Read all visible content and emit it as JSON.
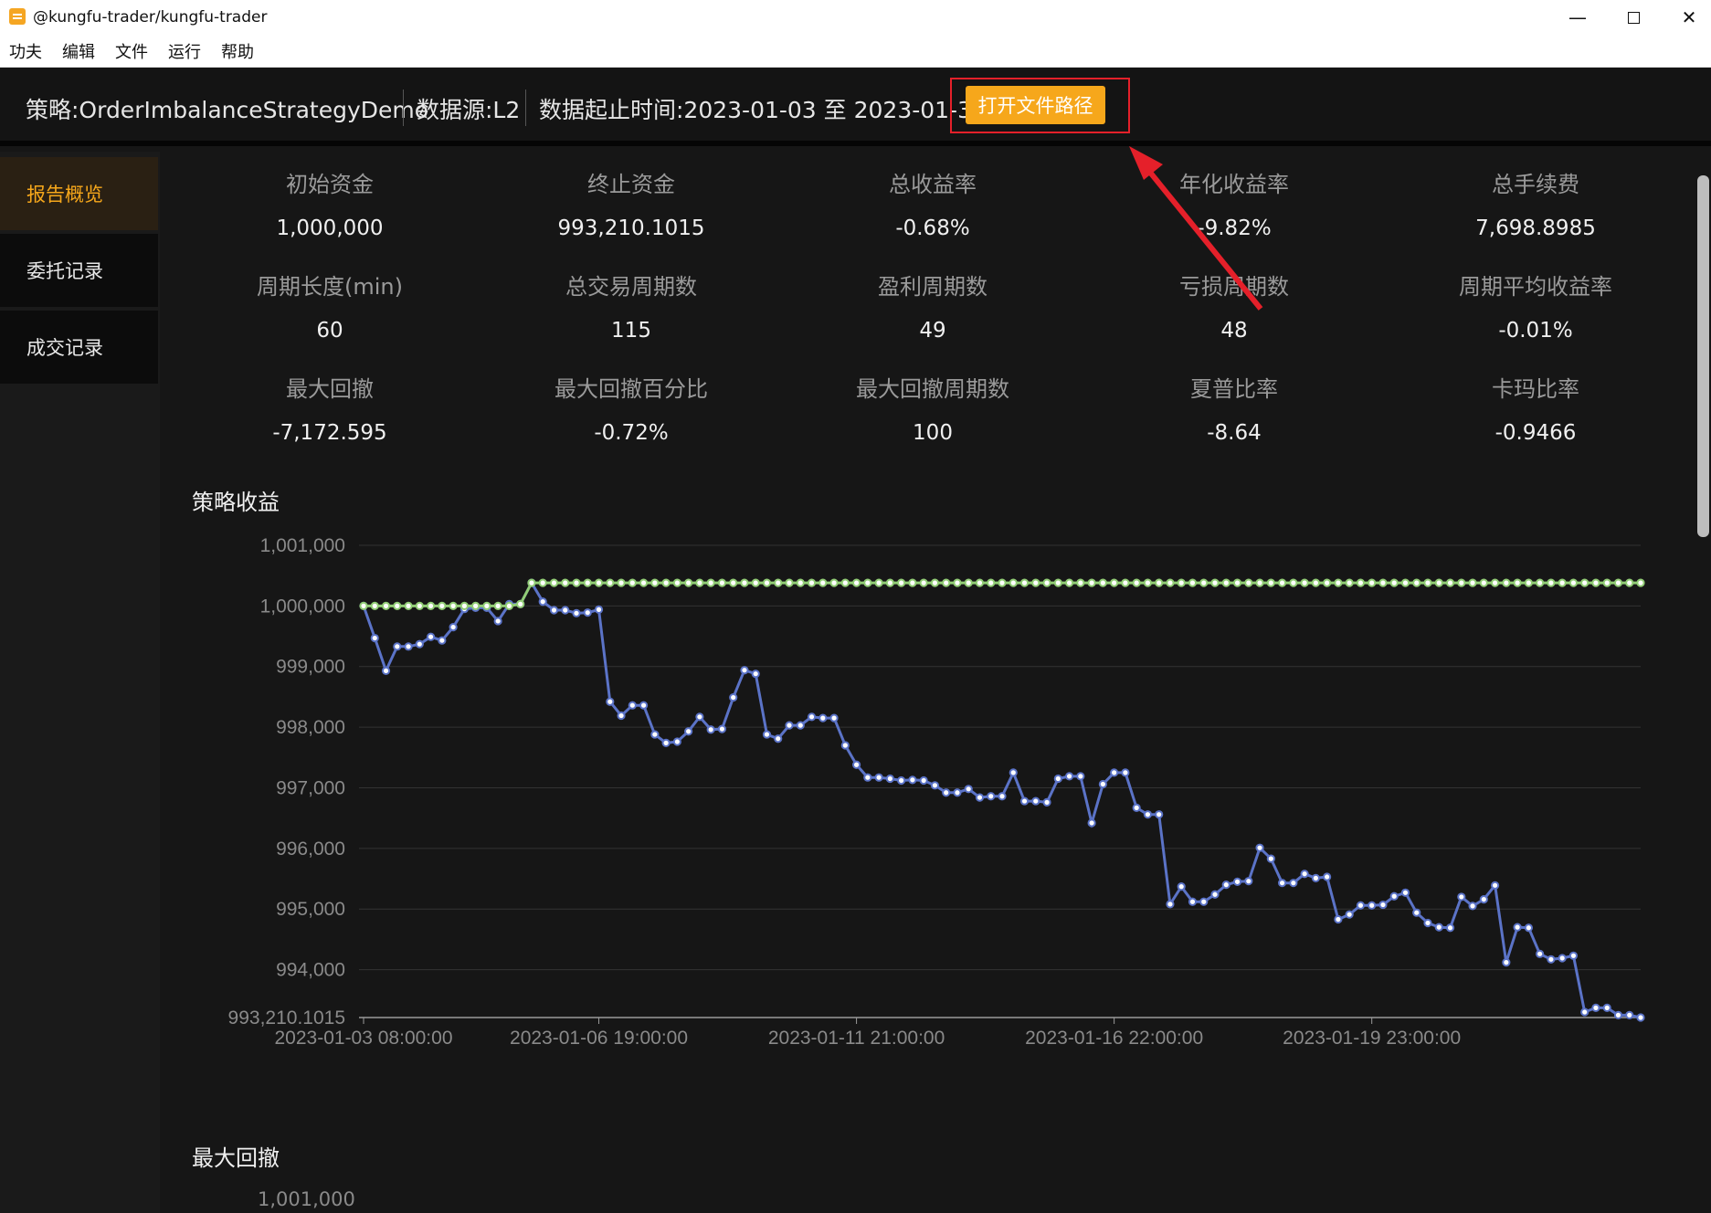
{
  "window": {
    "title": "@kungfu-trader/kungfu-trader",
    "min_glyph": "—",
    "close_glyph": "✕"
  },
  "menu": [
    "功夫",
    "编辑",
    "文件",
    "运行",
    "帮助"
  ],
  "header": {
    "strategy": "策略:OrderImbalanceStrategyDemo",
    "source": "数据源:L2",
    "range": "数据起止时间:2023-01-03 至 2023-01-31",
    "open_button": "打开文件路径"
  },
  "sidebar": {
    "items": [
      {
        "label": "报告概览",
        "active": true
      },
      {
        "label": "委托记录",
        "active": false
      },
      {
        "label": "成交记录",
        "active": false
      }
    ]
  },
  "stats": [
    {
      "label": "初始资金",
      "value": "1,000,000"
    },
    {
      "label": "终止资金",
      "value": "993,210.1015"
    },
    {
      "label": "总收益率",
      "value": "-0.68%"
    },
    {
      "label": "年化收益率",
      "value": "-9.82%"
    },
    {
      "label": "总手续费",
      "value": "7,698.8985"
    },
    {
      "label": "周期长度(min)",
      "value": "60"
    },
    {
      "label": "总交易周期数",
      "value": "115"
    },
    {
      "label": "盈利周期数",
      "value": "49"
    },
    {
      "label": "亏损周期数",
      "value": "48"
    },
    {
      "label": "周期平均收益率",
      "value": "-0.01%"
    },
    {
      "label": "最大回撤",
      "value": "-7,172.595"
    },
    {
      "label": "最大回撤百分比",
      "value": "-0.72%"
    },
    {
      "label": "最大回撤周期数",
      "value": "100"
    },
    {
      "label": "夏普比率",
      "value": "-8.64"
    },
    {
      "label": "卡玛比率",
      "value": "-0.9466"
    }
  ],
  "sections": {
    "returns_title": "策略收益",
    "drawdown_title": "最大回撤",
    "drawdown_first_tick": "1,001,000"
  },
  "colors": {
    "accent": "#f6a71b",
    "strategy_line": "#5b73c7",
    "benchmark_line": "#91cc75",
    "highlight": "#e5202a"
  },
  "chart_data": {
    "type": "line",
    "title": "策略收益",
    "y_ticks": [
      "1,001,000",
      "1,000,000",
      "999,000",
      "998,000",
      "997,000",
      "996,000",
      "995,000",
      "994,000",
      "993,210.1015"
    ],
    "ylim": [
      993210.1015,
      1001000
    ],
    "x_labels": [
      "2023-01-03 08:00:00",
      "2023-01-06 19:00:00",
      "2023-01-11 21:00:00",
      "2023-01-16 22:00:00",
      "2023-01-19 23:00:00"
    ],
    "x_label_index": [
      0,
      21,
      44,
      67,
      90
    ],
    "series": [
      {
        "values": [
          1000000,
          999470,
          998930,
          999330,
          999330,
          999370,
          999490,
          999430,
          999650,
          999950,
          999970,
          999970,
          999750,
          1000030,
          1000030,
          1000380,
          1000070,
          999930,
          999930,
          999880,
          999890,
          999940,
          998420,
          998190,
          998360,
          998360,
          997880,
          997740,
          997760,
          997930,
          998170,
          997960,
          997970,
          998490,
          998940,
          998880,
          997880,
          997810,
          998030,
          998030,
          998170,
          998150,
          998150,
          997700,
          997380,
          997170,
          997170,
          997150,
          997120,
          997130,
          997120,
          997040,
          996920,
          996920,
          996980,
          996840,
          996860,
          996860,
          997250,
          996780,
          996780,
          996760,
          997150,
          997190,
          997190,
          996420,
          997060,
          997250,
          997250,
          996670,
          996560,
          996560,
          995080,
          995370,
          995120,
          995120,
          995240,
          995400,
          995450,
          995460,
          996010,
          995830,
          995430,
          995430,
          995580,
          995510,
          995530,
          994830,
          994910,
          995060,
          995060,
          995070,
          995210,
          995270,
          994940,
          994770,
          994700,
          994690,
          995200,
          995050,
          995160,
          995390,
          994120,
          994700,
          994690,
          994260,
          994170,
          994190,
          994230,
          993300,
          993370,
          993370,
          993250,
          993250,
          993210
        ]
      },
      {
        "values": [
          1000000,
          1000000,
          1000000,
          1000000,
          1000000,
          1000000,
          1000000,
          1000000,
          1000000,
          1000000,
          1000000,
          1000000,
          1000000,
          1000000,
          1000030,
          1000380,
          1000380,
          1000380,
          1000380,
          1000380,
          1000380,
          1000380,
          1000380,
          1000380,
          1000380,
          1000380,
          1000380,
          1000380,
          1000380,
          1000380,
          1000380,
          1000380,
          1000380,
          1000380,
          1000380,
          1000380,
          1000380,
          1000380,
          1000380,
          1000380,
          1000380,
          1000380,
          1000380,
          1000380,
          1000380,
          1000380,
          1000380,
          1000380,
          1000380,
          1000380,
          1000380,
          1000380,
          1000380,
          1000380,
          1000380,
          1000380,
          1000380,
          1000380,
          1000380,
          1000380,
          1000380,
          1000380,
          1000380,
          1000380,
          1000380,
          1000380,
          1000380,
          1000380,
          1000380,
          1000380,
          1000380,
          1000380,
          1000380,
          1000380,
          1000380,
          1000380,
          1000380,
          1000380,
          1000380,
          1000380,
          1000380,
          1000380,
          1000380,
          1000380,
          1000380,
          1000380,
          1000380,
          1000380,
          1000380,
          1000380,
          1000380,
          1000380,
          1000380,
          1000380,
          1000380,
          1000380,
          1000380,
          1000380,
          1000380,
          1000380,
          1000380,
          1000380,
          1000380,
          1000380,
          1000380,
          1000380,
          1000380,
          1000380,
          1000380,
          1000380,
          1000380,
          1000380,
          1000380,
          1000380,
          1000380
        ]
      }
    ]
  }
}
